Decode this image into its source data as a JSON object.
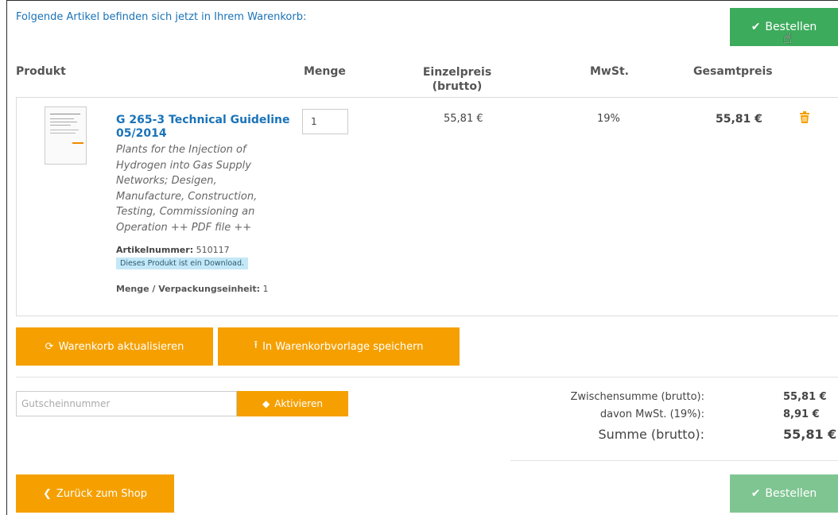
{
  "intro_text": "Folgende Artikel befinden sich jetzt in Ihrem Warenkorb:",
  "order_button_label": "Bestellen",
  "columns": {
    "product": "Produkt",
    "quantity": "Menge",
    "unit_price_line1": "Einzelpreis",
    "unit_price_line2": "(brutto)",
    "vat": "MwSt.",
    "total": "Gesamtpreis"
  },
  "item": {
    "title": "G 265-3 Technical Guideline 05/2014",
    "description": "Plants for the Injection of Hydrogen into Gas Supply Networks; Desigen, Manufacture, Construction, Testing, Commissioning an Operation ++ PDF file ++",
    "article_label": "Artikelnummer:",
    "article_number": "510117",
    "download_note": "Dieses Produkt ist ein Download.",
    "pack_label": "Menge / Verpackungseinheit:",
    "pack_value": "1",
    "quantity": "1",
    "unit_price": "55,81 €",
    "vat": "19%",
    "total": "55,81 €"
  },
  "buttons": {
    "update_cart": "Warenkorb aktualisieren",
    "save_template": "In Warenkorbvorlage speichern",
    "activate": "Aktivieren",
    "back": "Zurück zum Shop"
  },
  "coupon": {
    "placeholder": "Gutscheinnummer"
  },
  "summary": {
    "subtotal_label": "Zwischensumme (brutto):",
    "subtotal_value": "55,81 €",
    "vat_label": "davon MwSt. (19%):",
    "vat_value": "8,91 €",
    "total_label": "Summe (brutto):",
    "total_value": "55,81 €"
  },
  "colors": {
    "green": "#3dab5c",
    "orange": "#f5a000",
    "link_blue": "#1a73b8"
  }
}
